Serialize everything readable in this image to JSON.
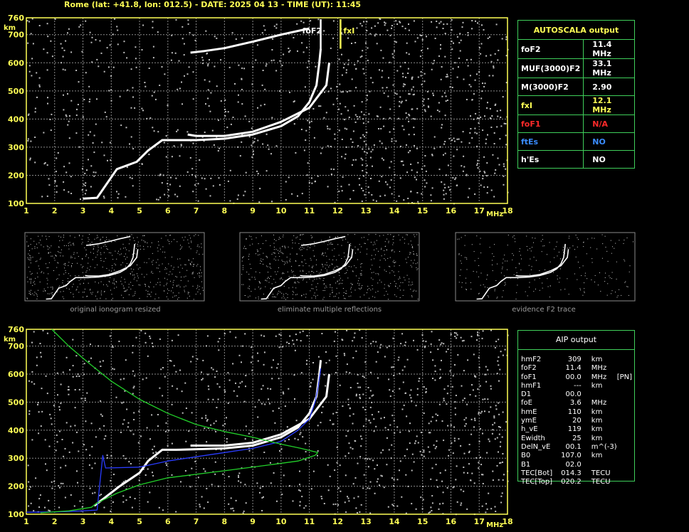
{
  "header": "Rome (lat: +41.8, lon: 012.5) - DATE: 2025 04 13 - TIME (UT): 11:45",
  "chart_data": [
    {
      "type": "scatter",
      "xlabel": "MHz",
      "ylabel": "km",
      "xlim": [
        1,
        18
      ],
      "ylim": [
        100,
        760
      ],
      "xticks": [
        "1",
        "2",
        "3",
        "4",
        "5",
        "6",
        "7",
        "8",
        "9",
        "10",
        "11",
        "12",
        "13",
        "14",
        "15",
        "16",
        "17",
        "18"
      ],
      "yticks": [
        "100",
        "200",
        "300",
        "400",
        "500",
        "600",
        "700",
        "760"
      ],
      "annotations": [
        {
          "text": "foF2",
          "x": 11.4,
          "color": "#ffffff"
        },
        {
          "text": "fxI",
          "x": 12.1,
          "color": "#ffff55"
        }
      ],
      "series": [
        {
          "name": "O-trace",
          "points": [
            [
              3,
              117
            ],
            [
              3.5,
              120
            ],
            [
              4.2,
              222
            ],
            [
              4.9,
              248
            ],
            [
              5.3,
              288
            ],
            [
              5.8,
              325
            ],
            [
              6.3,
              325
            ],
            [
              7,
              325
            ],
            [
              8,
              330
            ],
            [
              9,
              345
            ],
            [
              10,
              375
            ],
            [
              10.6,
              410
            ],
            [
              11,
              460
            ],
            [
              11.25,
              520
            ],
            [
              11.35,
              600
            ],
            [
              11.4,
              650
            ]
          ]
        },
        {
          "name": "X-trace",
          "points": [
            [
              6.7,
              345
            ],
            [
              7,
              340
            ],
            [
              8,
              340
            ],
            [
              9,
              355
            ],
            [
              10,
              390
            ],
            [
              11,
              440
            ],
            [
              11.6,
              520
            ],
            [
              11.7,
              600
            ]
          ]
        },
        {
          "name": "upper-trace",
          "points": [
            [
              6.8,
              636
            ],
            [
              7.3,
              642
            ],
            [
              8,
              652
            ],
            [
              9,
              675
            ],
            [
              10,
              700
            ],
            [
              11,
              722
            ]
          ]
        }
      ]
    },
    {
      "type": "line",
      "xlabel": "MHz",
      "ylabel": "km",
      "xlim": [
        1,
        18
      ],
      "ylim": [
        100,
        760
      ],
      "xticks": [
        "1",
        "2",
        "3",
        "4",
        "5",
        "6",
        "7",
        "8",
        "9",
        "10",
        "11",
        "12",
        "13",
        "14",
        "15",
        "16",
        "17",
        "18"
      ],
      "yticks": [
        "100",
        "200",
        "300",
        "400",
        "500",
        "600",
        "700",
        "760"
      ],
      "series": [
        {
          "name": "O-trace",
          "color": "#ffffff",
          "points": [
            [
              3.4,
              130
            ],
            [
              4.3,
              200
            ],
            [
              5,
              248
            ],
            [
              5.3,
              290
            ],
            [
              5.8,
              330
            ],
            [
              6.3,
              330
            ],
            [
              7,
              332
            ],
            [
              8,
              335
            ],
            [
              9,
              345
            ],
            [
              10,
              375
            ],
            [
              10.6,
              410
            ],
            [
              11,
              460
            ],
            [
              11.25,
              520
            ],
            [
              11.35,
              600
            ],
            [
              11.4,
              650
            ]
          ]
        },
        {
          "name": "X-trace",
          "color": "#ffffff",
          "points": [
            [
              6.8,
              345
            ],
            [
              8,
              345
            ],
            [
              9,
              355
            ],
            [
              10,
              385
            ],
            [
              11,
              440
            ],
            [
              11.6,
              520
            ],
            [
              11.7,
              600
            ]
          ]
        },
        {
          "name": "electron-density-profile",
          "color": "#2a3cff",
          "points": [
            [
              1,
              107
            ],
            [
              2,
              108
            ],
            [
              3,
              112
            ],
            [
              3.5,
              115
            ],
            [
              3.7,
              310
            ],
            [
              3.8,
              265
            ],
            [
              5,
              268
            ],
            [
              6,
              290
            ],
            [
              7,
              305
            ],
            [
              8,
              320
            ],
            [
              9,
              335
            ],
            [
              10,
              360
            ],
            [
              10.6,
              400
            ],
            [
              11,
              440
            ],
            [
              11.2,
              500
            ],
            [
              11.3,
              550
            ],
            [
              11.4,
              620
            ]
          ]
        },
        {
          "name": "model-profile",
          "color": "#22d02a",
          "points": [
            [
              1.9,
              760
            ],
            [
              2.5,
              700
            ],
            [
              3.2,
              640
            ],
            [
              4,
              575
            ],
            [
              5,
              510
            ],
            [
              6,
              460
            ],
            [
              7,
              420
            ],
            [
              8,
              395
            ],
            [
              9,
              375
            ],
            [
              10,
              350
            ],
            [
              10.7,
              335
            ],
            [
              11.3,
              320
            ],
            [
              11.2,
              310
            ],
            [
              10.6,
              290
            ],
            [
              9.5,
              275
            ],
            [
              8,
              255
            ],
            [
              6,
              230
            ],
            [
              5,
              205
            ],
            [
              4.2,
              175
            ],
            [
              3.7,
              150
            ],
            [
              3.5,
              140
            ],
            [
              3.3,
              125
            ],
            [
              2.5,
              112
            ],
            [
              1.5,
              105
            ]
          ]
        }
      ]
    }
  ],
  "thumbnails": [
    {
      "caption": "original ionogram resized"
    },
    {
      "caption": "eliminate multiple reflections"
    },
    {
      "caption": "evidence F2 trace"
    }
  ],
  "autoscala": {
    "title": "AUTOSCALA output",
    "rows": [
      {
        "label": "foF2",
        "value": "11.4 MHz",
        "color": "#ffffff"
      },
      {
        "label": "MUF(3000)F2",
        "value": "33.1 MHz",
        "color": "#ffffff"
      },
      {
        "label": "M(3000)F2",
        "value": "2.90",
        "color": "#ffffff"
      },
      {
        "label": "fxI",
        "value": "12.1 MHz",
        "color": "#ffff55"
      },
      {
        "label": "foF1",
        "value": "N/A",
        "color": "#ff2a2a"
      },
      {
        "label": "ftEs",
        "value": "NO",
        "color": "#3a8cff"
      },
      {
        "label": "h'Es",
        "value": "NO",
        "color": "#ffffff"
      }
    ]
  },
  "aip": {
    "title": "AIP output",
    "rows": [
      {
        "name": "hmF2",
        "value": "309",
        "unit": "km",
        "extra": ""
      },
      {
        "name": "foF2",
        "value": "11.4",
        "unit": "MHz",
        "extra": ""
      },
      {
        "name": "foF1",
        "value": "00.0",
        "unit": "MHz",
        "extra": "[PN]"
      },
      {
        "name": "hmF1",
        "value": "---",
        "unit": "km",
        "extra": ""
      },
      {
        "name": "D1",
        "value": "00.0",
        "unit": "",
        "extra": ""
      },
      {
        "name": "foE",
        "value": "3.6",
        "unit": "MHz",
        "extra": ""
      },
      {
        "name": "hmE",
        "value": "110",
        "unit": "km",
        "extra": ""
      },
      {
        "name": "ymE",
        "value": "20",
        "unit": "km",
        "extra": ""
      },
      {
        "name": "h_vE",
        "value": "119",
        "unit": "km",
        "extra": ""
      },
      {
        "name": "Ewidth",
        "value": "25",
        "unit": "km",
        "extra": ""
      },
      {
        "name": "DelN_vE",
        "value": "00.1",
        "unit": "m^(-3)",
        "extra": ""
      },
      {
        "name": "B0",
        "value": "107.0",
        "unit": "km",
        "extra": ""
      },
      {
        "name": "B1",
        "value": "02.0",
        "unit": "",
        "extra": ""
      },
      {
        "name": "TEC[Bot]",
        "value": "014.3",
        "unit": "TECU",
        "extra": ""
      },
      {
        "name": "TEC[Top]",
        "value": "020.2",
        "unit": "TECU",
        "extra": ""
      }
    ]
  }
}
